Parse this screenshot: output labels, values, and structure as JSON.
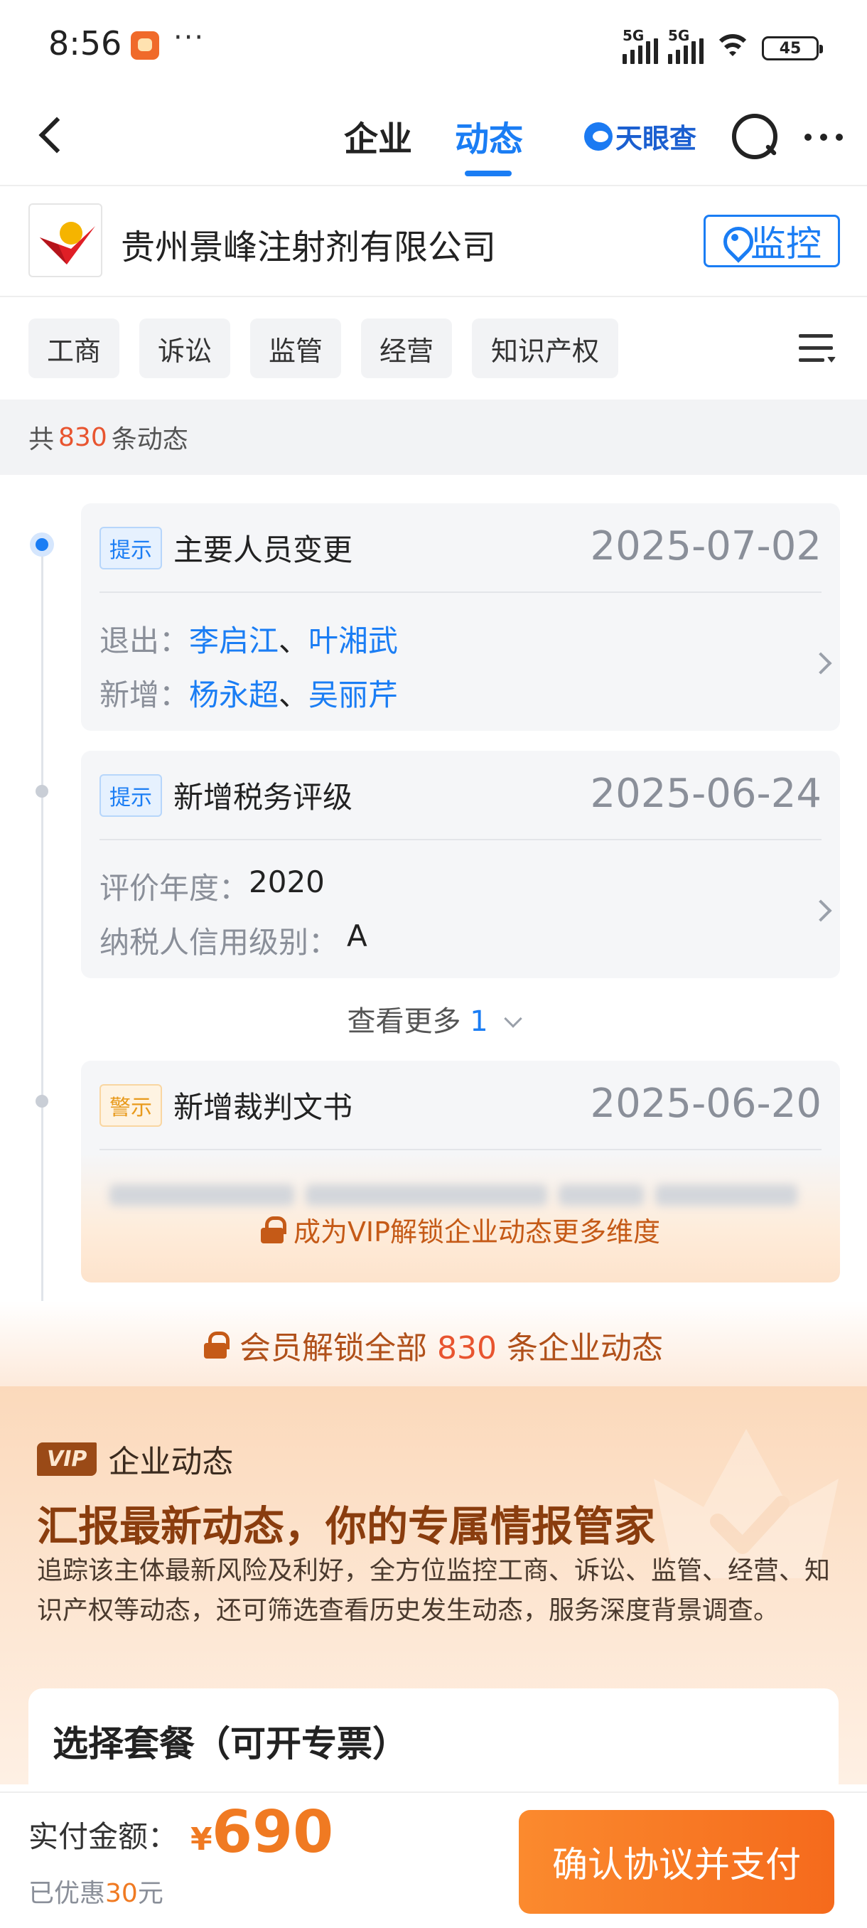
{
  "status_bar": {
    "time": "8:56",
    "dots": "···",
    "signal1": "5G",
    "signal2": "5G",
    "battery": "45"
  },
  "nav": {
    "tabs": [
      {
        "label": "企业",
        "active": false
      },
      {
        "label": "动态",
        "active": true
      }
    ],
    "brand": "天眼查",
    "accent_color": "#1a7df4"
  },
  "company": {
    "name": "贵州景峰注射剂有限公司",
    "monitor_label": "监控"
  },
  "filters": [
    "工商",
    "诉讼",
    "监管",
    "经营",
    "知识产权"
  ],
  "count": {
    "prefix": "共",
    "number": "830",
    "suffix": "条动态"
  },
  "events": [
    {
      "badge": "提示",
      "title": "主要人员变更",
      "date": "2025-07-02",
      "rows": [
        {
          "label": "退出：",
          "names": [
            "李启江",
            "叶湘武"
          ]
        },
        {
          "label": "新增：",
          "names": [
            "杨永超",
            "吴丽芹"
          ]
        }
      ]
    },
    {
      "badge": "提示",
      "title": "新增税务评级",
      "date": "2025-06-24",
      "rows": [
        {
          "label": "评价年度：",
          "value": "2020"
        },
        {
          "label": "纳税人信用级别：",
          "value": "A"
        }
      ]
    },
    {
      "badge": "警示",
      "title": "新增裁判文书",
      "date": "2025-06-20",
      "locked_text": "成为VIP解锁企业动态更多维度"
    }
  ],
  "see_more": {
    "label": "查看更多",
    "count": "1"
  },
  "member_unlock": {
    "prefix": "会员解锁全部",
    "number": "830",
    "suffix": "条企业动态"
  },
  "promo": {
    "vip_tag": "VIP",
    "section": "企业动态",
    "title": "汇报最新动态，你的专属情报管家",
    "description": "追踪该主体最新风险及利好，全方位监控工商、诉讼、监管、经营、知识产权等动态，还可筛选查看历史发生动态，服务深度背景调查。",
    "package_title": "选择套餐（可开专票）"
  },
  "payment": {
    "label": "实付金额：",
    "currency": "¥",
    "amount": "690",
    "discount_prefix": "已优惠",
    "discount_amount": "30",
    "discount_suffix": "元",
    "button": "确认协议并支付"
  }
}
